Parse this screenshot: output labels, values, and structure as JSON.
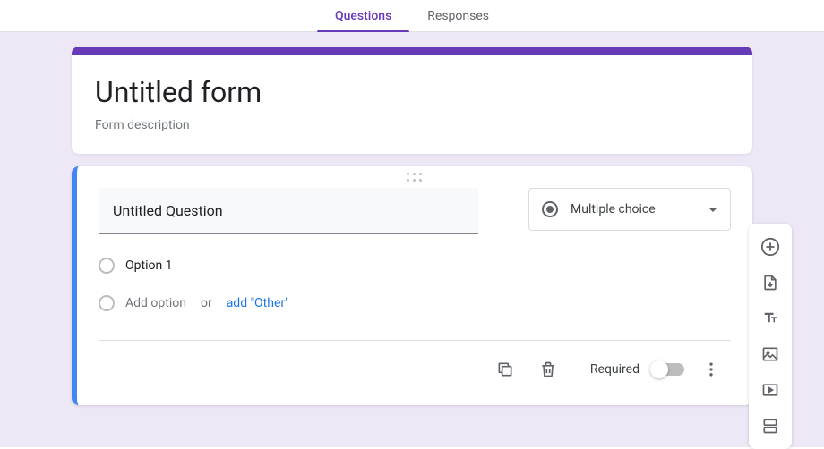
{
  "tabs": {
    "questions": "Questions",
    "responses": "Responses"
  },
  "header": {
    "title": "Untitled form",
    "description": "Form description"
  },
  "question": {
    "title": "Untitled Question",
    "type": "Multiple choice",
    "options": [
      "Option 1"
    ],
    "addOption": "Add option",
    "or": "or",
    "addOther": "add \"Other\""
  },
  "footer": {
    "required": "Required"
  }
}
